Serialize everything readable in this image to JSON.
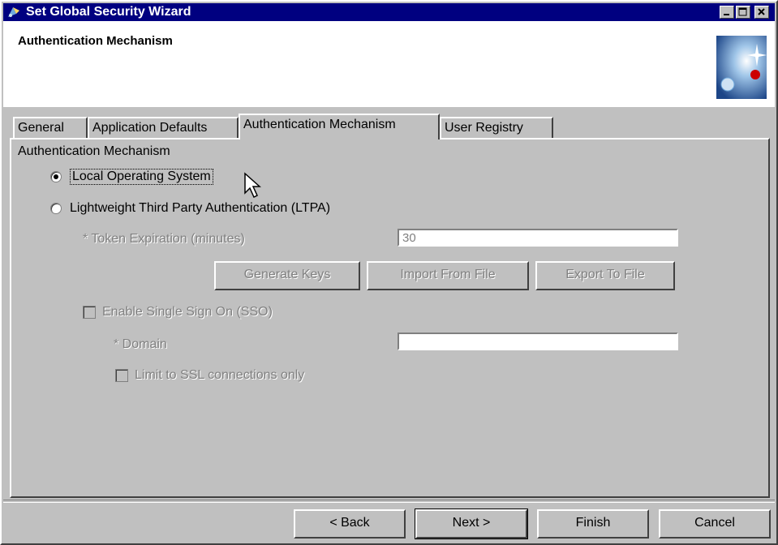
{
  "window": {
    "title": "Set Global Security Wizard",
    "controls": {
      "minimize_icon": "minimize-icon",
      "maximize_icon": "maximize-icon",
      "close_icon": "close-icon"
    }
  },
  "header": {
    "title": "Authentication Mechanism",
    "graphic_icon": "globe-sparkle-icon"
  },
  "tabs": [
    {
      "label": "General",
      "active": false
    },
    {
      "label": "Application Defaults",
      "active": false
    },
    {
      "label": "Authentication Mechanism",
      "active": true
    },
    {
      "label": "User Registry",
      "active": false
    }
  ],
  "panel": {
    "section_label": "Authentication Mechanism",
    "radio_local": {
      "label": "Local Operating System",
      "checked": true
    },
    "radio_ltpa": {
      "label": "Lightweight Third Party Authentication (LTPA)",
      "checked": false
    },
    "token_expiration": {
      "label": "* Token Expiration (minutes)",
      "value": "30"
    },
    "buttons": {
      "generate_keys": "Generate Keys",
      "import_from_file": "Import From File",
      "export_to_file": "Export To File"
    },
    "enable_sso": {
      "label": "Enable Single Sign On (SSO)",
      "checked": false
    },
    "domain": {
      "label": "* Domain",
      "value": ""
    },
    "limit_ssl": {
      "label": "Limit to SSL connections only",
      "checked": false
    }
  },
  "footer": {
    "back": "< Back",
    "next": "Next >",
    "finish": "Finish",
    "cancel": "Cancel"
  },
  "colors": {
    "titlebar": "#000080",
    "face": "#c0c0c0",
    "disabled_text": "#808080"
  }
}
